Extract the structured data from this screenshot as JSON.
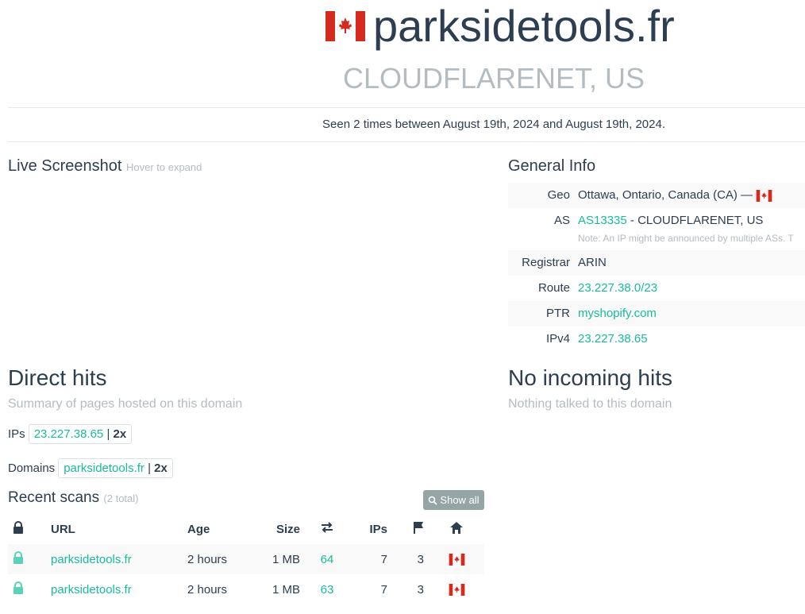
{
  "header": {
    "domain": "parksidetools.fr",
    "asn_name": "CLOUDFLARENET, US",
    "seen": "Seen 2 times between August 19th, 2024 and August 19th, 2024."
  },
  "screenshot": {
    "title": "Live Screenshot",
    "hint": "Hover to expand"
  },
  "general_info": {
    "title": "General Info",
    "geo_label": "Geo",
    "geo_value": "Ottawa, Ontario, Canada (CA) —",
    "as_label": "AS",
    "as_link": "AS13335",
    "as_rest": " - CLOUDFLARENET, US",
    "as_note": "Note: An IP might be announced by multiple ASs. T",
    "registrar_label": "Registrar",
    "registrar_value": "ARIN",
    "route_label": "Route",
    "route_value": "23.227.38.0/23",
    "ptr_label": "PTR",
    "ptr_value": "myshopify.com",
    "ipv4_label": "IPv4",
    "ipv4_value": "23.227.38.65"
  },
  "direct_hits": {
    "title": "Direct hits",
    "subtitle": "Summary of pages hosted on this domain",
    "ips_label": "IPs",
    "ip_value": "23.227.38.65",
    "ip_count": "2x",
    "domains_label": "Domains",
    "domain_value": "parksidetools.fr",
    "domain_count": "2x",
    "separator": "|"
  },
  "incoming": {
    "title": "No incoming hits",
    "subtitle": "Nothing talked to this domain"
  },
  "recent_scans": {
    "title": "Recent scans",
    "total": "(2 total)",
    "show_all": "Show all",
    "columns": [
      "URL",
      "Age",
      "Size",
      "IPs"
    ],
    "rows": [
      {
        "url": "parksidetools.fr",
        "age": "2 hours",
        "size": "1 MB",
        "requests": "64",
        "ips": "7",
        "countries": "3"
      },
      {
        "url": "parksidetools.fr",
        "age": "2 hours",
        "size": "1 MB",
        "requests": "63",
        "ips": "7",
        "countries": "3"
      }
    ]
  },
  "colors": {
    "accent": "#18bc9c",
    "text": "#2c3e50",
    "muted": "#b4bcc2",
    "flag_red": "#d52b1e"
  },
  "icons": [
    "canada-flag-icon",
    "lock-icon",
    "transfer-icon",
    "flag-icon",
    "home-icon",
    "search-icon"
  ]
}
